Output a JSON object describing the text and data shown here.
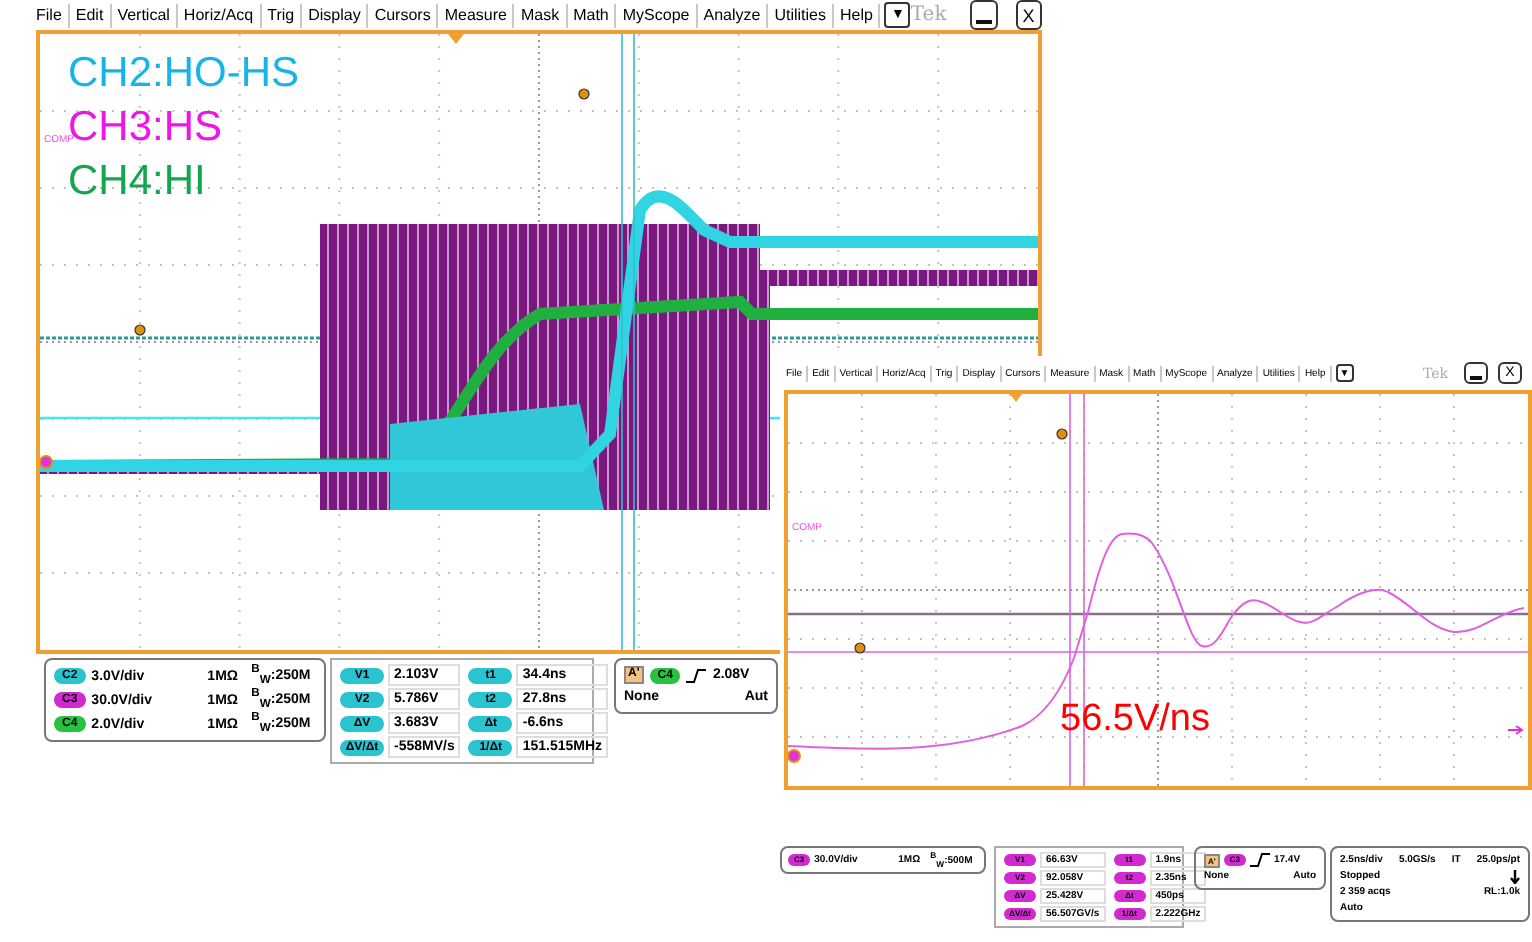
{
  "windows": [
    {
      "kind": "main",
      "menu": [
        "File",
        "Edit",
        "Vertical",
        "Horiz/Acq",
        "Trig",
        "Display",
        "Cursors",
        "Measure",
        "Mask",
        "Math",
        "MyScope",
        "Analyze",
        "Utilities",
        "Help"
      ],
      "logo": "Tek",
      "controls": {
        "dropdown": "▼",
        "close": "X"
      },
      "plot": {
        "ref_label": "COMP",
        "labels": [
          {
            "text": "CH2:HO-HS",
            "color": "#19b4e6"
          },
          {
            "text": "CH3:HS",
            "color": "#f014e6"
          },
          {
            "text": "CH4:HI",
            "color": "#14a550"
          }
        ]
      },
      "channels": [
        {
          "badge": "C2",
          "color": "#2ac4d0",
          "scale": "3.0V/div",
          "impedance": "1MΩ",
          "bandwidth": "$^{B}$$_{W}$:250M"
        },
        {
          "badge": "C3",
          "color": "#d02ad0",
          "scale": "30.0V/div",
          "impedance": "1MΩ",
          "bandwidth": "$^{B}$$_{W}$:250M"
        },
        {
          "badge": "C4",
          "color": "#2ac040",
          "scale": "2.0V/div",
          "impedance": "1MΩ",
          "bandwidth": "$^{B}$$_{W}$:250M"
        }
      ],
      "cursors": [
        {
          "label": "V1",
          "value": "2.103V"
        },
        {
          "label": "t1",
          "value": "34.4ns"
        },
        {
          "label": "V2",
          "value": "5.786V"
        },
        {
          "label": "t2",
          "value": "27.8ns"
        },
        {
          "label": "ΔV",
          "value": "3.683V"
        },
        {
          "label": "Δt",
          "value": "-6.6ns"
        },
        {
          "label": "ΔV/Δt",
          "value": "-558MV/s"
        },
        {
          "label": "1/Δt",
          "value": "151.515MHz"
        }
      ],
      "trigger": {
        "source": "A'",
        "badge": "C4",
        "color": "#2ac040",
        "threshold": "2.08V",
        "coupling": "None",
        "mode": "Aut"
      }
    },
    {
      "kind": "zoom",
      "menu": [
        "File",
        "Edit",
        "Vertical",
        "Horiz/Acq",
        "Trig",
        "Display",
        "Cursors",
        "Measure",
        "Mask",
        "Math",
        "MyScope",
        "Analyze",
        "Utilities",
        "Help"
      ],
      "logo": "Tek",
      "controls": {
        "dropdown": "▼",
        "close": "X"
      },
      "plot": {
        "ref_label": "COMP",
        "annotation": "56.5V/ns"
      },
      "channels": [
        {
          "badge": "C3",
          "color": "#d02ad0",
          "scale": "30.0V/div",
          "impedance": "1MΩ",
          "bandwidth": "$^{B}$$_{W}$:500M"
        }
      ],
      "cursors": [
        {
          "label": "V1",
          "value": "66.63V"
        },
        {
          "label": "t1",
          "value": "1.9ns"
        },
        {
          "label": "V2",
          "value": "92.058V"
        },
        {
          "label": "t2",
          "value": "2.35ns"
        },
        {
          "label": "ΔV",
          "value": "25.428V"
        },
        {
          "label": "Δt",
          "value": "450ps"
        },
        {
          "label": "ΔV/Δt",
          "value": "56.507GV/s"
        },
        {
          "label": "1/Δt",
          "value": "2.222GHz"
        }
      ],
      "trigger": {
        "source": "A'",
        "badge": "C3",
        "color": "#d02ad0",
        "threshold": "17.4V",
        "coupling": "None",
        "mode": "Auto"
      },
      "timebase": [
        [
          "2.5ns/div",
          "5.0GS/s",
          "IT",
          "25.0ps/pt"
        ],
        [
          "Stopped"
        ],
        [
          "2 359 acqs",
          "RL:1.0k"
        ],
        [
          "Auto"
        ]
      ]
    }
  ]
}
